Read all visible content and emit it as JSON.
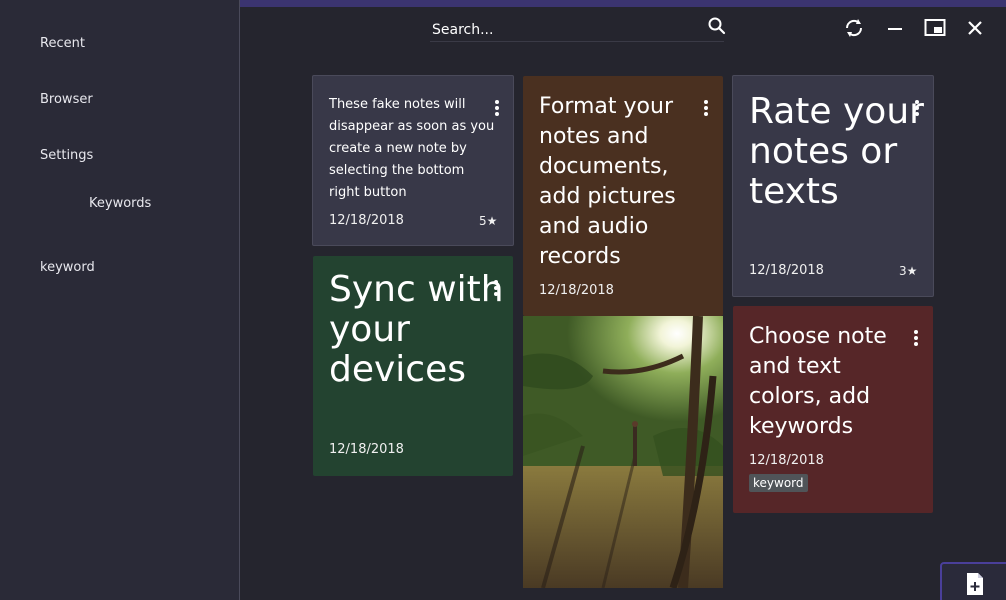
{
  "sidebar": {
    "items": [
      {
        "label": "Recent"
      },
      {
        "label": "Browser"
      },
      {
        "label": "Settings"
      },
      {
        "label": "Keywords"
      },
      {
        "label": "keyword"
      }
    ]
  },
  "header": {
    "search_placeholder": "Search...",
    "icons": [
      "search-icon",
      "sync-icon",
      "minimize-icon",
      "maximize-icon",
      "close-icon"
    ]
  },
  "notes": [
    {
      "text": "These fake notes will disappear as soon as you create a new note by selecting the bottom right button",
      "date": "12/18/2018",
      "rating": "5★",
      "color": "#383848"
    },
    {
      "text": "Format your notes and documents, add pictures and audio records",
      "date": "12/18/2018",
      "color": "#4a3020"
    },
    {
      "text": "Rate your notes or texts",
      "date": "12/18/2018",
      "rating": "3★",
      "color": "#383848"
    },
    {
      "text": "Sync with your devices",
      "date": "12/18/2018",
      "color": "#234330"
    },
    {
      "text": "Choose note and text colors, add keywords",
      "date": "12/18/2018",
      "keyword": "keyword",
      "color": "#562628"
    }
  ],
  "colors": {
    "background": "#25252e",
    "sidebar": "#2a2a37",
    "accent": "#3b3470"
  },
  "fab": {
    "icon": "add-note-icon"
  }
}
